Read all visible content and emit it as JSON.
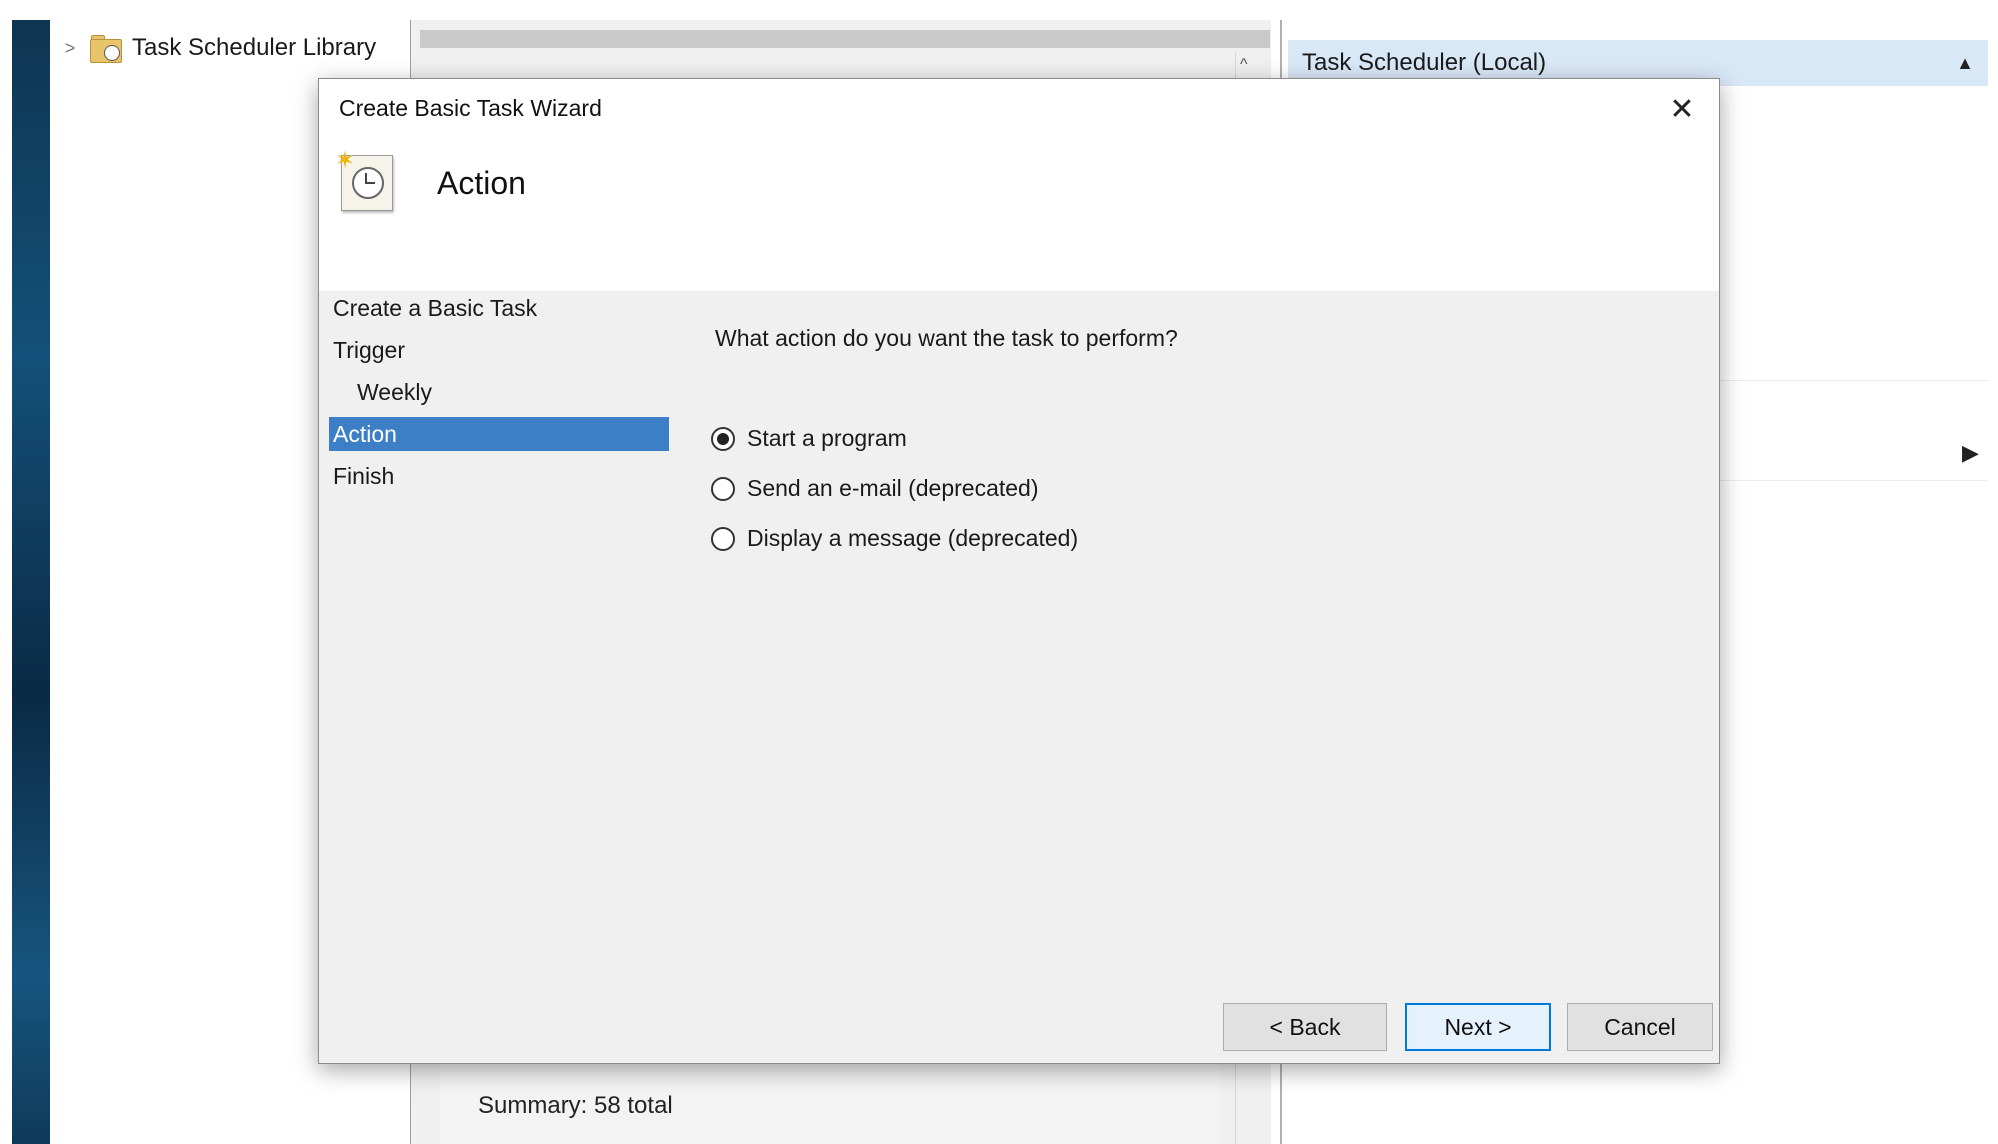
{
  "background": {
    "tree_item_label": "Task Scheduler Library",
    "actions_header": "Task Scheduler (Local)",
    "summary": "Summary: 58 total"
  },
  "dialog": {
    "title": "Create Basic Task Wizard",
    "heading": "Action",
    "steps": [
      {
        "label": "Create a Basic Task",
        "active": false,
        "indent": false
      },
      {
        "label": "Trigger",
        "active": false,
        "indent": false
      },
      {
        "label": "Weekly",
        "active": false,
        "indent": true
      },
      {
        "label": "Action",
        "active": true,
        "indent": false
      },
      {
        "label": "Finish",
        "active": false,
        "indent": false
      }
    ],
    "question": "What action do you want the task to perform?",
    "options": [
      {
        "label": "Start a program",
        "checked": true
      },
      {
        "label": "Send an e-mail (deprecated)",
        "checked": false
      },
      {
        "label": "Display a message (deprecated)",
        "checked": false
      }
    ],
    "buttons": {
      "back": "< Back",
      "next": "Next >",
      "cancel": "Cancel"
    }
  },
  "colors": {
    "selection": "#3c7fc7",
    "header_highlight": "#d9e8f7",
    "default_button_border": "#0078d7"
  }
}
